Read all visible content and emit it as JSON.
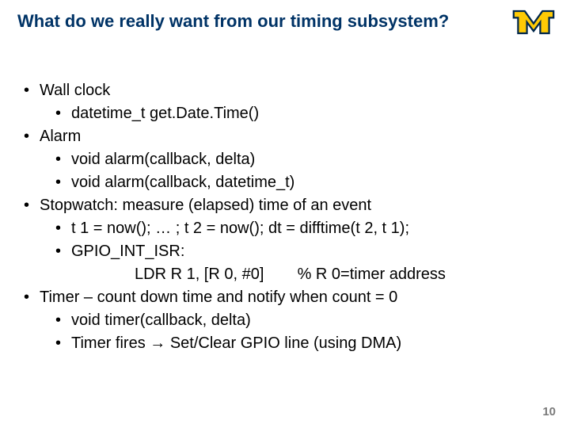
{
  "title": "What do we really want from our timing subsystem?",
  "logo_alt": "University of Michigan block M logo",
  "bullets": {
    "b1": "Wall clock",
    "b1a": "datetime_t get.Date.Time()",
    "b2": "Alarm",
    "b2a": "void alarm(callback, delta)",
    "b2b": "void alarm(callback, datetime_t)",
    "b3": "Stopwatch: measure (elapsed) time of an event",
    "b3a": "t 1 = now(); … ; t 2 = now(); dt = difftime(t 2, t 1);",
    "b3b": "GPIO_INT_ISR:",
    "b3b_asm_left": "LDR R 1, [R 0, #0]",
    "b3b_asm_right": "% R 0=timer address",
    "b4": "Timer – count down time and notify when count = 0",
    "b4a": "void timer(callback, delta)",
    "b4b": "Timer fires → Set/Clear GPIO line (using DMA)"
  },
  "page_number": "10"
}
